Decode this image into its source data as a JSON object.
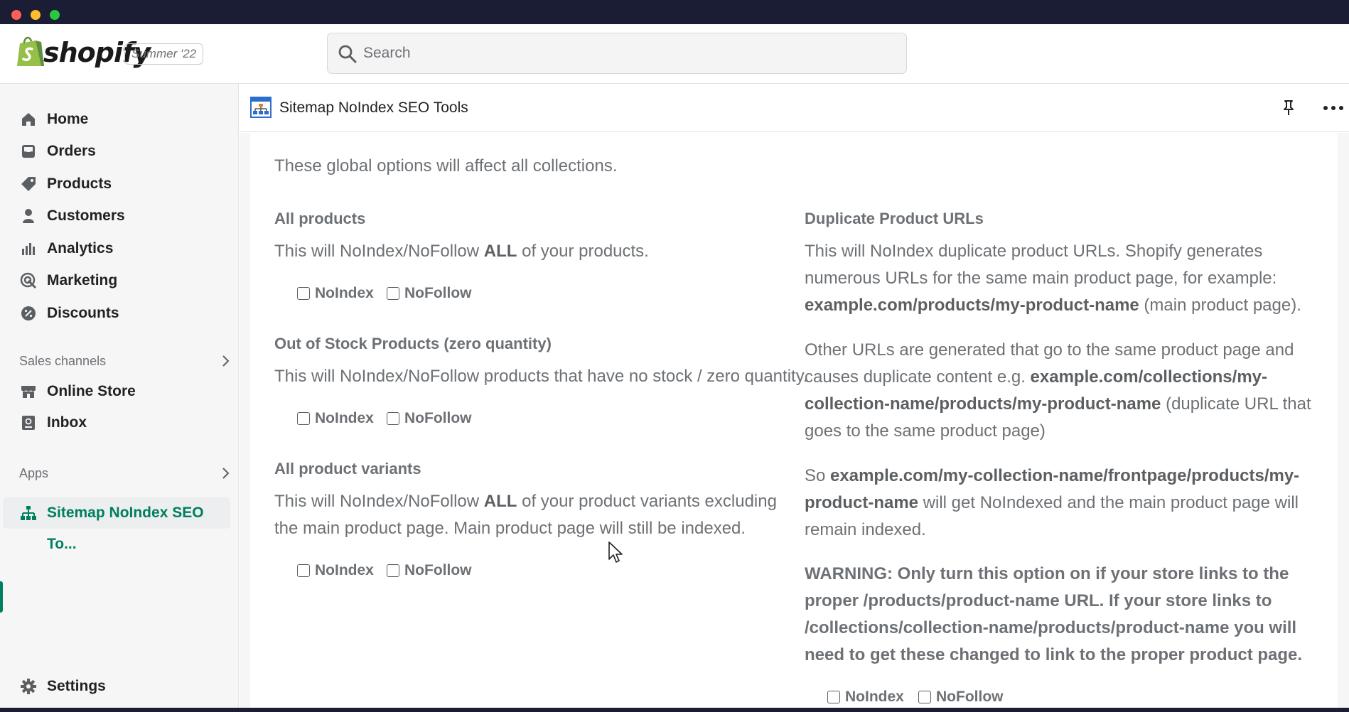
{
  "window": {
    "traffic_lights": [
      "close",
      "minimize",
      "zoom"
    ]
  },
  "topbar": {
    "brand": "shopify",
    "edition": "Summer '22",
    "search_placeholder": "Search"
  },
  "sidebar": {
    "items": [
      {
        "label": "Home",
        "icon": "home-icon"
      },
      {
        "label": "Orders",
        "icon": "orders-icon"
      },
      {
        "label": "Products",
        "icon": "tag-icon"
      },
      {
        "label": "Customers",
        "icon": "person-icon"
      },
      {
        "label": "Analytics",
        "icon": "bar-chart-icon"
      },
      {
        "label": "Marketing",
        "icon": "target-icon"
      },
      {
        "label": "Discounts",
        "icon": "discount-icon"
      }
    ],
    "sales_channels_heading": "Sales channels",
    "sales_channels": [
      {
        "label": "Online Store",
        "icon": "store-icon"
      },
      {
        "label": "Inbox",
        "icon": "inbox-icon"
      }
    ],
    "apps_heading": "Apps",
    "apps": [
      {
        "label": "Sitemap NoIndex SEO To...",
        "icon": "sitemap-icon",
        "active": true
      }
    ],
    "settings_label": "Settings"
  },
  "app_header": {
    "title": "Sitemap NoIndex SEO Tools"
  },
  "content": {
    "intro": "These global options will affect all collections.",
    "checkbox_labels": {
      "noindex": "NoIndex",
      "nofollow": "NoFollow"
    },
    "all_products": {
      "heading": "All products",
      "desc_pre": "This will NoIndex/NoFollow ",
      "desc_bold": "ALL",
      "desc_post": " of your products."
    },
    "out_of_stock": {
      "heading": "Out of Stock Products (zero quantity)",
      "desc": "This will NoIndex/NoFollow products that have no stock / zero quantity."
    },
    "variants": {
      "heading": "All product variants",
      "desc_pre": "This will NoIndex/NoFollow ",
      "desc_bold": "ALL",
      "desc_post": " of your product variants excluding the main product page. Main product page will still be indexed."
    },
    "duplicate": {
      "heading": "Duplicate Product URLs",
      "p1_pre": "This will NoIndex duplicate product URLs. Shopify generates numerous URLs for the same main product page, for example: ",
      "p1_bold": "example.com/products/my-product-name",
      "p1_post": " (main product page).",
      "p2_pre": "Other URLs are generated that go to the same product page and causes duplicate content e.g. ",
      "p2_bold": "example.com/collections/my-collection-name/products/my-product-name",
      "p2_post": " (duplicate URL that goes to the same product page)",
      "p3_pre": "So ",
      "p3_bold": "example.com/my-collection-name/frontpage/products/my-product-name",
      "p3_post": " will get NoIndexed and the main product page will remain indexed.",
      "warning": "WARNING: Only turn this option on if your store links to the proper /products/product-name URL. If your store links to /collections/collection-name/products/product-name you will need to get these changed to link to the proper product page."
    }
  }
}
